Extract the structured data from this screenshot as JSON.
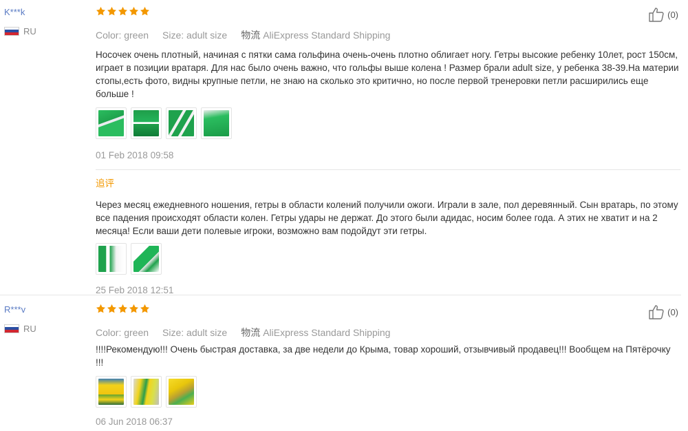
{
  "reviews": [
    {
      "user": "K***k",
      "country": "RU",
      "rating": 5,
      "likes": "(0)",
      "color": "Color: green",
      "size": "Size: adult size",
      "shipping_zh": "物流",
      "shipping": "AliExpress Standard Shipping",
      "text": "Носочек очень плотный, начиная с пятки сама гольфина очень-очень плотно облигает ногу. Гетры высокие ребенку 10лет, рост 150см, играет в позиции вратаря. Для нас было очень важно, что гольфы выше колена !  Размер брали adult size, у ребенка 38-39.На материи стопы,есть фото, видны крупные петли, не знаю на сколько это критично, но после первой тренеровки петли расширились еще больше !",
      "images": [
        "green-sock-photo-1",
        "green-sock-photo-2",
        "green-sock-photo-3",
        "green-sock-photo-4"
      ],
      "date": "01 Feb 2018 09:58",
      "followup": {
        "label": "追评",
        "text": "Через месяц ежедневного ношения, гетры в области колений получили ожоги. Играли в зале, пол деревянный. Сын вратарь, по этому все падения происходят области колен. Гетры удары не держат. До этого были адидас, носим более года. А этих не хватит и на 2 месяца! Если ваши дети полевые игроки, возможно вам подойдут эти гетры.",
        "images": [
          "green-sock-followup-1",
          "green-sock-followup-2"
        ],
        "date": "25 Feb 2018 12:51"
      }
    },
    {
      "user": "R***v",
      "country": "RU",
      "rating": 5,
      "likes": "(0)",
      "color": "Color: green",
      "size": "Size: adult size",
      "shipping_zh": "物流",
      "shipping": "AliExpress Standard Shipping",
      "text": "!!!!Рекомендую!!! Очень быстрая доставка, за две недели до Крыма, товар хороший, отзывчивый продавец!!! Вообщем на Пятёрочку !!!",
      "images": [
        "yellow-sock-photo-1",
        "yellow-sock-photo-2",
        "yellow-sock-photo-3"
      ],
      "date": "06 Jun 2018 06:37"
    }
  ],
  "colors": {
    "username": "#5b7cc4",
    "star": "#f39800",
    "muted": "#999999",
    "followup_label": "#f39800"
  },
  "icons": {
    "star": "star-icon",
    "like": "thumbs-up-icon",
    "flag": "russia-flag-icon"
  }
}
